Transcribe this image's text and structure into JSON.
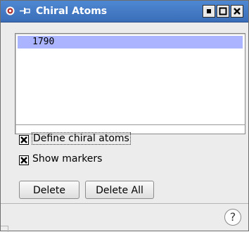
{
  "window": {
    "title": "Chiral Atoms",
    "title_icon": "app-logo-icon",
    "pin_icon": "pin-icon",
    "controls": [
      "minimize-icon",
      "maximize-icon",
      "close-icon"
    ],
    "titlebar_color": "#3f78c8"
  },
  "atom_list": {
    "items": [
      "1790"
    ],
    "selected_index": 0,
    "selection_color": "#aab4ff"
  },
  "options": {
    "define_chiral_atoms": {
      "label": "Define chiral atoms",
      "checked": true
    },
    "show_markers": {
      "label": "Show markers",
      "checked": true
    }
  },
  "buttons": {
    "delete_label": "Delete",
    "delete_all_label": "Delete All"
  },
  "help": {
    "label": "?"
  }
}
